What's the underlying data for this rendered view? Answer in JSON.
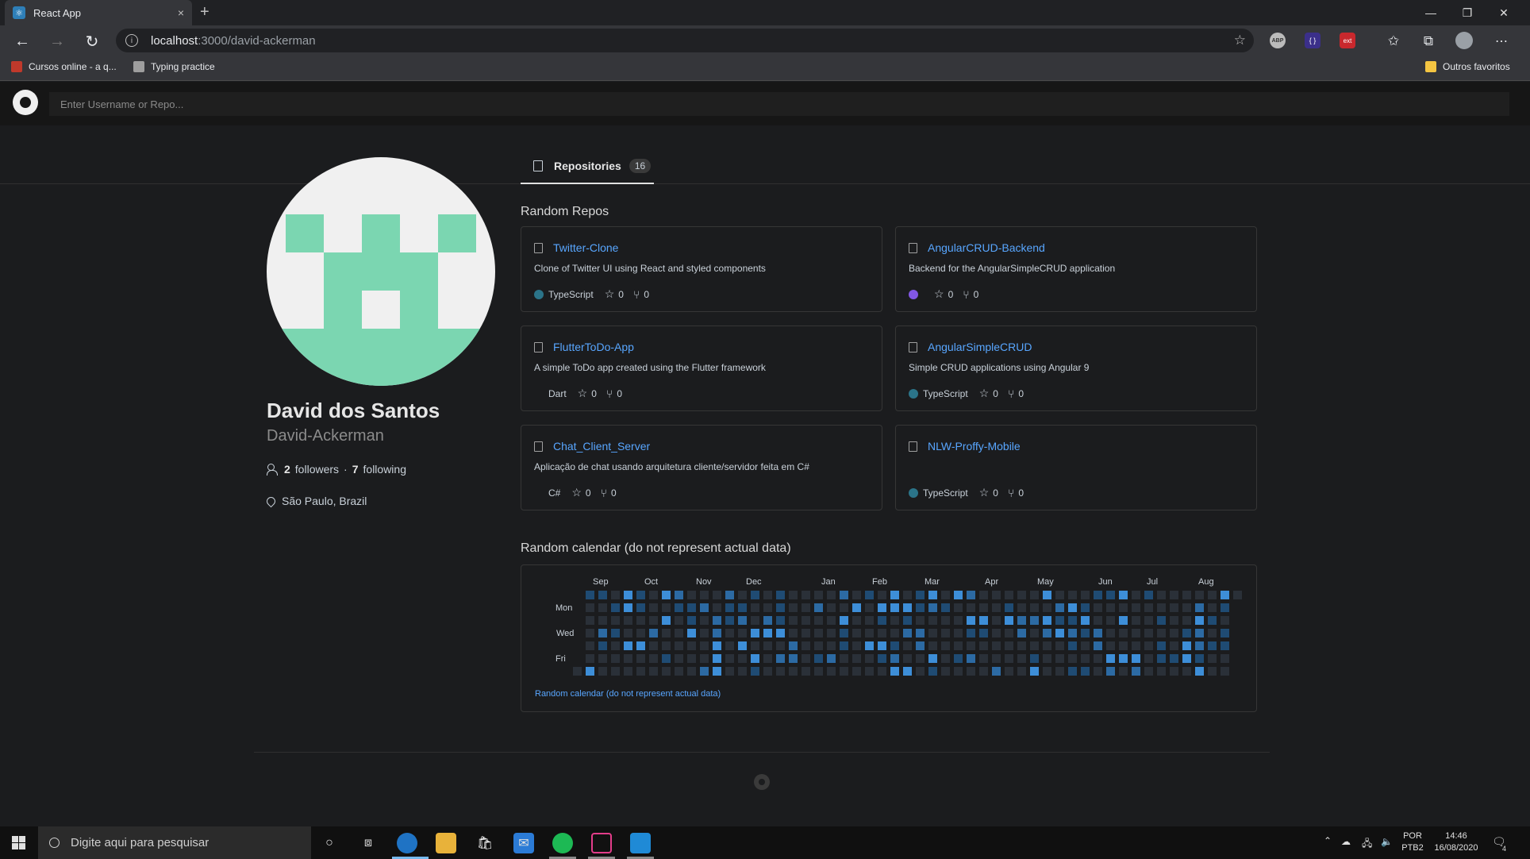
{
  "browser": {
    "tab_title": "React App",
    "tab_close": "×",
    "new_tab": "+",
    "url_host": "localhost",
    "url_path": ":3000/david-ackerman",
    "bookmarks": [
      "Cursos online - a q...",
      "Typing practice"
    ],
    "other_bookmarks": "Outros favoritos",
    "extensions": [
      "ABP",
      "{ }",
      "ext"
    ]
  },
  "header": {
    "search_placeholder": "Enter Username or Repo..."
  },
  "tabs": {
    "repositories_label": "Repositories",
    "repositories_count": "16"
  },
  "profile": {
    "name": "David dos Santos",
    "login": "David-Ackerman",
    "followers_count": "2",
    "followers_label": "followers",
    "separator": "·",
    "following_count": "7",
    "following_label": "following",
    "location": "São Paulo, Brazil"
  },
  "repos": {
    "section_title": "Random Repos",
    "items": [
      {
        "name": "Twitter-Clone",
        "description": "Clone of Twitter UI using React and styled components",
        "language": "TypeScript",
        "lang_color": "#2b7489",
        "stars": "0",
        "forks": "0"
      },
      {
        "name": "AngularCRUD-Backend",
        "description": "Backend for the AngularSimpleCRUD application",
        "language": "",
        "lang_color": "#8257e5",
        "stars": "0",
        "forks": "0"
      },
      {
        "name": "FlutterToDo-App",
        "description": "A simple ToDo app created using the Flutter framework",
        "language": "Dart",
        "lang_color": "",
        "stars": "0",
        "forks": "0"
      },
      {
        "name": "AngularSimpleCRUD",
        "description": "Simple CRUD applications using Angular 9",
        "language": "TypeScript",
        "lang_color": "#2b7489",
        "stars": "0",
        "forks": "0"
      },
      {
        "name": "Chat_Client_Server",
        "description": "Aplicação de chat usando arquitetura cliente/servidor feita em C#",
        "language": "C#",
        "lang_color": "",
        "stars": "0",
        "forks": "0"
      },
      {
        "name": "NLW-Proffy-Mobile",
        "description": "",
        "language": "TypeScript",
        "lang_color": "#2b7489",
        "stars": "0",
        "forks": "0"
      }
    ]
  },
  "calendar": {
    "section_title": "Random calendar (do not represent actual data)",
    "months": [
      "Sep",
      "Oct",
      "Nov",
      "Dec",
      "Jan",
      "Feb",
      "Mar",
      "Apr",
      "May",
      "Jun",
      "Jul",
      "Aug"
    ],
    "days": [
      "Mon",
      "Wed",
      "Fri"
    ],
    "note": "Random calendar (do not represent actual data)",
    "colors": [
      "#2a3038",
      "#1f4b73",
      "#2c6aa3",
      "#3d8ed8"
    ]
  },
  "taskbar": {
    "search_placeholder": "Digite aqui para pesquisar",
    "lang_top": "POR",
    "lang_bottom": "PTB2",
    "time": "14:46",
    "date": "16/08/2020",
    "notif_count": "4"
  }
}
